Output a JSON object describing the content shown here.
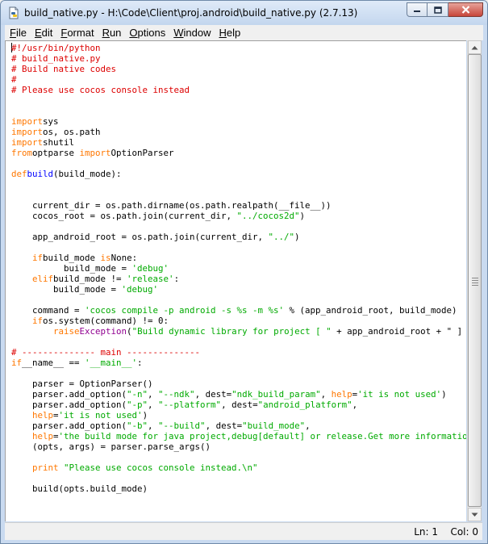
{
  "window": {
    "title": "build_native.py - H:\\Code\\Client\\proj.android\\build_native.py (2.7.13)"
  },
  "menu": [
    "File",
    "Edit",
    "Format",
    "Run",
    "Options",
    "Window",
    "Help"
  ],
  "colors": {
    "comment": "#dd0000",
    "keyword": "#ff7700",
    "string": "#00aa00",
    "definition": "#0000ff",
    "builtin": "#900090"
  },
  "code": {
    "lines": [
      [
        [
          "cmt",
          "#!/usr/bin/python"
        ]
      ],
      [
        [
          "cmt",
          "# build_native.py"
        ]
      ],
      [
        [
          "cmt",
          "# Build native codes"
        ]
      ],
      [
        [
          "cmt",
          "#"
        ]
      ],
      [
        [
          "cmt",
          "# Please use cocos console instead"
        ]
      ],
      [],
      [],
      [
        [
          "kw",
          "import"
        ],
        [
          "",
          "sys"
        ]
      ],
      [
        [
          "kw",
          "import"
        ],
        [
          "",
          "os, os.path"
        ]
      ],
      [
        [
          "kw",
          "import"
        ],
        [
          "",
          "shutil"
        ]
      ],
      [
        [
          "kw",
          "from"
        ],
        [
          "",
          "optparse "
        ],
        [
          "kw",
          "import"
        ],
        [
          "",
          "OptionParser"
        ]
      ],
      [],
      [
        [
          "kw",
          "def"
        ],
        [
          "def",
          "build"
        ],
        [
          "",
          "(build_mode):"
        ]
      ],
      [],
      [],
      [
        [
          "",
          "    current_dir = os.path.dirname(os.path.realpath(__file__))"
        ]
      ],
      [
        [
          "",
          "    cocos_root = os.path.join(current_dir, "
        ],
        [
          "str",
          "\"../cocos2d\""
        ],
        [
          "",
          ")"
        ]
      ],
      [],
      [
        [
          "",
          "    app_android_root = os.path.join(current_dir, "
        ],
        [
          "str",
          "\"../\""
        ],
        [
          "",
          ")"
        ]
      ],
      [],
      [
        [
          "",
          "    "
        ],
        [
          "kw",
          "if"
        ],
        [
          "",
          "build_mode "
        ],
        [
          "kw",
          "is"
        ],
        [
          "",
          "None:"
        ]
      ],
      [
        [
          "",
          "          build_mode = "
        ],
        [
          "str",
          "'debug'"
        ]
      ],
      [
        [
          "",
          "    "
        ],
        [
          "kw",
          "elif"
        ],
        [
          "",
          "build_mode != "
        ],
        [
          "str",
          "'release'"
        ],
        [
          "",
          ":"
        ]
      ],
      [
        [
          "",
          "        build_mode = "
        ],
        [
          "str",
          "'debug'"
        ]
      ],
      [],
      [
        [
          "",
          "    command = "
        ],
        [
          "str",
          "'cocos compile -p android -s %s -m %s'"
        ],
        [
          "",
          " % (app_android_root, build_mode)"
        ]
      ],
      [
        [
          "",
          "    "
        ],
        [
          "kw",
          "if"
        ],
        [
          "",
          "os.system(command) != 0:"
        ]
      ],
      [
        [
          "",
          "        "
        ],
        [
          "kw",
          "raise"
        ],
        [
          "bi",
          "Exception"
        ],
        [
          "",
          "("
        ],
        [
          "str",
          "\"Build dynamic library for project [ \""
        ],
        [
          "",
          " + app_android_root + \" ] fails!\")"
        ]
      ],
      [],
      [
        [
          "cmt",
          "# -------------- main --------------"
        ]
      ],
      [
        [
          "kw",
          "if"
        ],
        [
          "",
          "__name__ == "
        ],
        [
          "str",
          "'__main__'"
        ],
        [
          "",
          ":"
        ]
      ],
      [],
      [
        [
          "",
          "    parser = OptionParser()"
        ]
      ],
      [
        [
          "",
          "    parser.add_option("
        ],
        [
          "str",
          "\"-n\""
        ],
        [
          "",
          ", "
        ],
        [
          "str",
          "\"--ndk\""
        ],
        [
          "",
          ", dest="
        ],
        [
          "str",
          "\"ndk_build_param\""
        ],
        [
          "",
          ", "
        ],
        [
          "kw",
          "help"
        ],
        [
          "",
          "="
        ],
        [
          "str",
          "'it is not used'"
        ],
        [
          "",
          ")"
        ]
      ],
      [
        [
          "",
          "    parser.add_option("
        ],
        [
          "str",
          "\"-p\""
        ],
        [
          "",
          ", "
        ],
        [
          "str",
          "\"--platform\""
        ],
        [
          "",
          ", dest="
        ],
        [
          "str",
          "\"android_platform\""
        ],
        [
          "",
          ","
        ]
      ],
      [
        [
          "",
          "    "
        ],
        [
          "kw",
          "help"
        ],
        [
          "",
          "="
        ],
        [
          "str",
          "'it is not used'"
        ],
        [
          "",
          ")"
        ]
      ],
      [
        [
          "",
          "    parser.add_option("
        ],
        [
          "str",
          "\"-b\""
        ],
        [
          "",
          ", "
        ],
        [
          "str",
          "\"--build\""
        ],
        [
          "",
          ", dest="
        ],
        [
          "str",
          "\"build_mode\""
        ],
        [
          "",
          ","
        ]
      ],
      [
        [
          "",
          "    "
        ],
        [
          "kw",
          "help"
        ],
        [
          "",
          "="
        ],
        [
          "str",
          "'the build mode for java project,debug[default] or release.Get more information,please refer to'"
        ],
        [
          "",
          ")"
        ]
      ],
      [
        [
          "",
          "    (opts, args) = parser.parse_args()"
        ]
      ],
      [],
      [
        [
          "",
          "    "
        ],
        [
          "kw",
          "print"
        ],
        [
          "",
          ""
        ],
        [
          "str",
          " \"Please use cocos console instead.\\n\""
        ]
      ],
      [],
      [
        [
          "",
          "    build(opts.build_mode)"
        ]
      ]
    ]
  },
  "status": {
    "line": "Ln: 1",
    "col": "Col: 0"
  }
}
